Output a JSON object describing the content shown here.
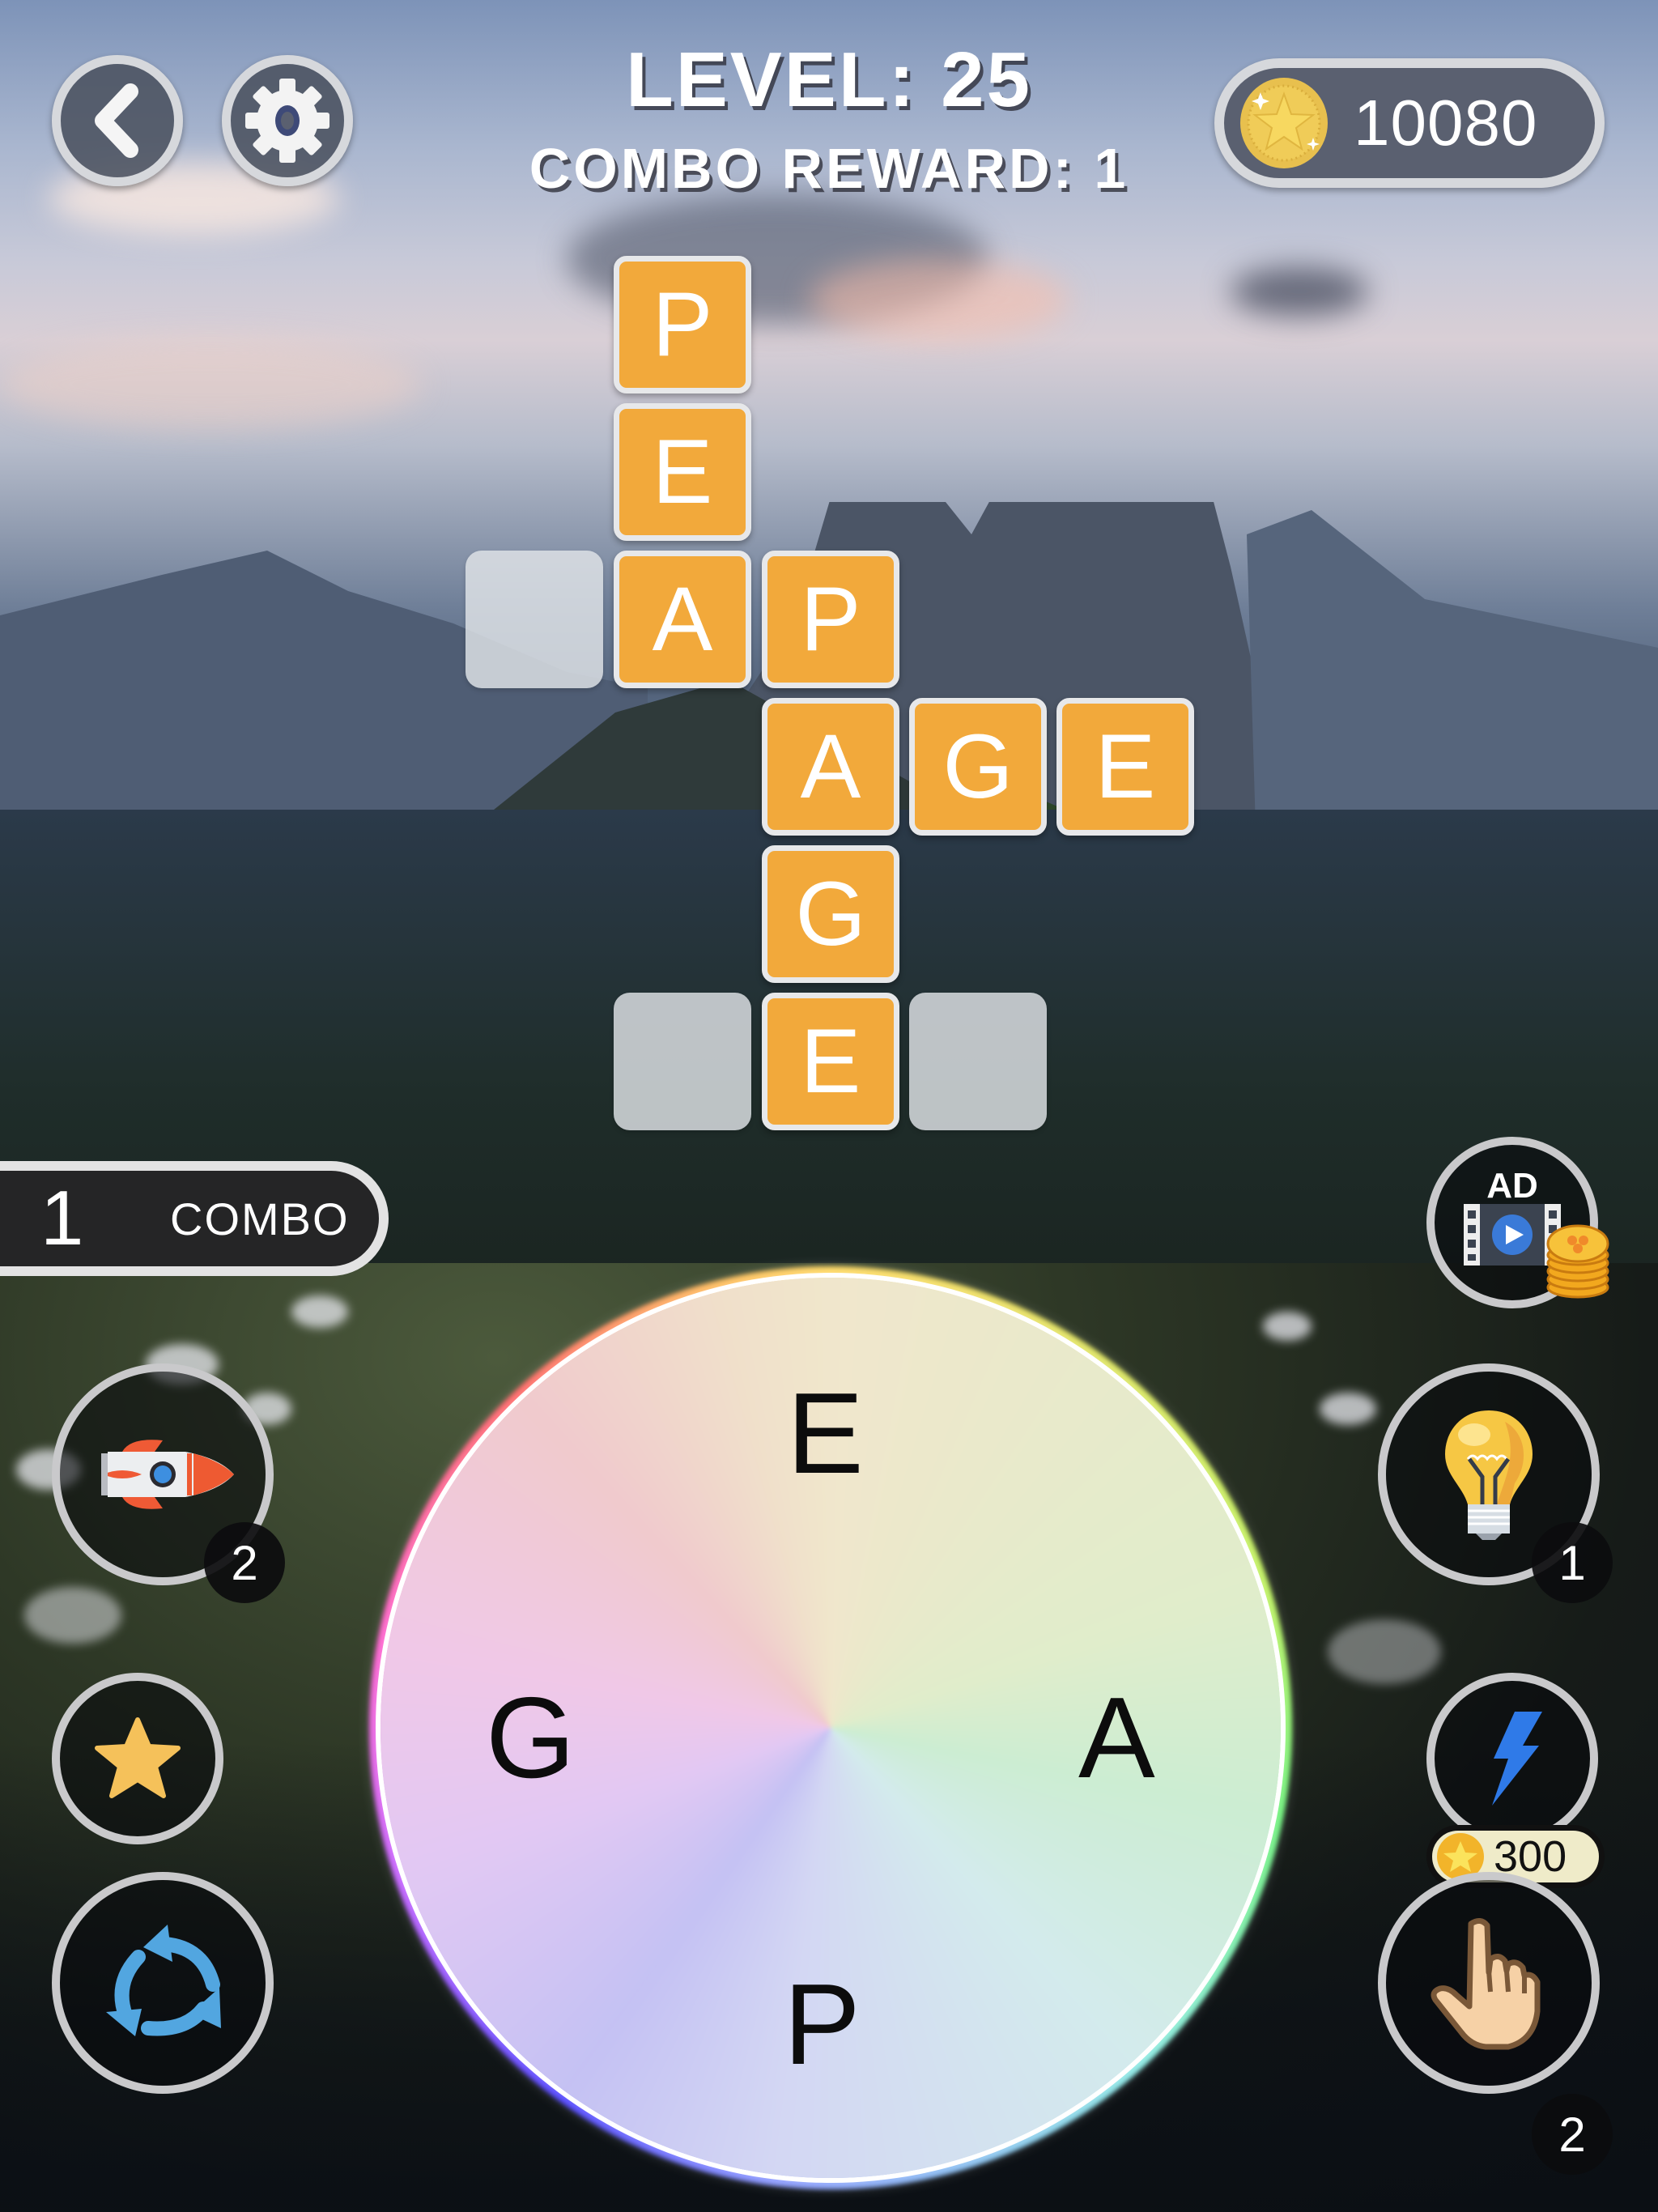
{
  "header": {
    "level_text": "LEVEL: 25",
    "combo_reward_text": "COMBO REWARD: 1",
    "coins": "10080"
  },
  "buttons": {
    "back": "back",
    "settings": "settings"
  },
  "grid": {
    "solved_words": [
      "PEA",
      "PAGE",
      "AGE"
    ],
    "cells": [
      {
        "row": 0,
        "col": 1,
        "letter": "P",
        "state": "filled"
      },
      {
        "row": 1,
        "col": 1,
        "letter": "E",
        "state": "filled"
      },
      {
        "row": 2,
        "col": 0,
        "letter": "",
        "state": "empty"
      },
      {
        "row": 2,
        "col": 1,
        "letter": "A",
        "state": "filled"
      },
      {
        "row": 2,
        "col": 2,
        "letter": "P",
        "state": "filled"
      },
      {
        "row": 3,
        "col": 2,
        "letter": "A",
        "state": "filled"
      },
      {
        "row": 3,
        "col": 3,
        "letter": "G",
        "state": "filled"
      },
      {
        "row": 3,
        "col": 4,
        "letter": "E",
        "state": "filled"
      },
      {
        "row": 4,
        "col": 2,
        "letter": "G",
        "state": "filled"
      },
      {
        "row": 5,
        "col": 1,
        "letter": "",
        "state": "empty"
      },
      {
        "row": 5,
        "col": 2,
        "letter": "E",
        "state": "filled"
      },
      {
        "row": 5,
        "col": 3,
        "letter": "",
        "state": "empty"
      }
    ],
    "tile_color": "#F2A93B",
    "letter_color": "#FFFFFF"
  },
  "combo": {
    "count": "1",
    "label": "COMBO"
  },
  "tools": {
    "rocket": {
      "icon": "rocket-icon",
      "count": "2"
    },
    "star": {
      "icon": "star-icon"
    },
    "shuffle": {
      "icon": "shuffle-icon"
    },
    "ad": {
      "icon": "ad-video-icon",
      "label": "AD"
    },
    "hint": {
      "icon": "lightbulb-icon",
      "count": "1"
    },
    "bolt": {
      "icon": "lightning-icon",
      "cost": "300"
    },
    "finger": {
      "icon": "pointing-finger-icon",
      "count": "2"
    }
  },
  "wheel": {
    "letters": {
      "top": "E",
      "left": "G",
      "right": "A",
      "bottom": "P"
    }
  }
}
